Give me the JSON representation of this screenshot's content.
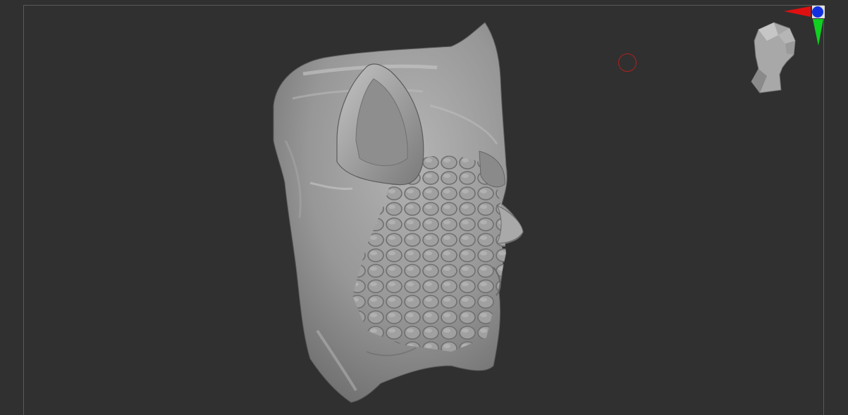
{
  "canvas": {
    "background": "#303030",
    "frame_color": "#5a5a5a"
  },
  "model": {
    "icon": "sculpted-creature-head-side-view",
    "material_color": "#9a9a9a"
  },
  "cursor": {
    "icon": "brush-cursor-ring",
    "color": "#b02020"
  },
  "axis_gizmo": {
    "x_color": "#e01010",
    "y_color": "#10d020",
    "z_color": "#1030e0"
  },
  "navigation_head": {
    "icon": "navigation-head-icon",
    "color": "#a8a8a8"
  }
}
